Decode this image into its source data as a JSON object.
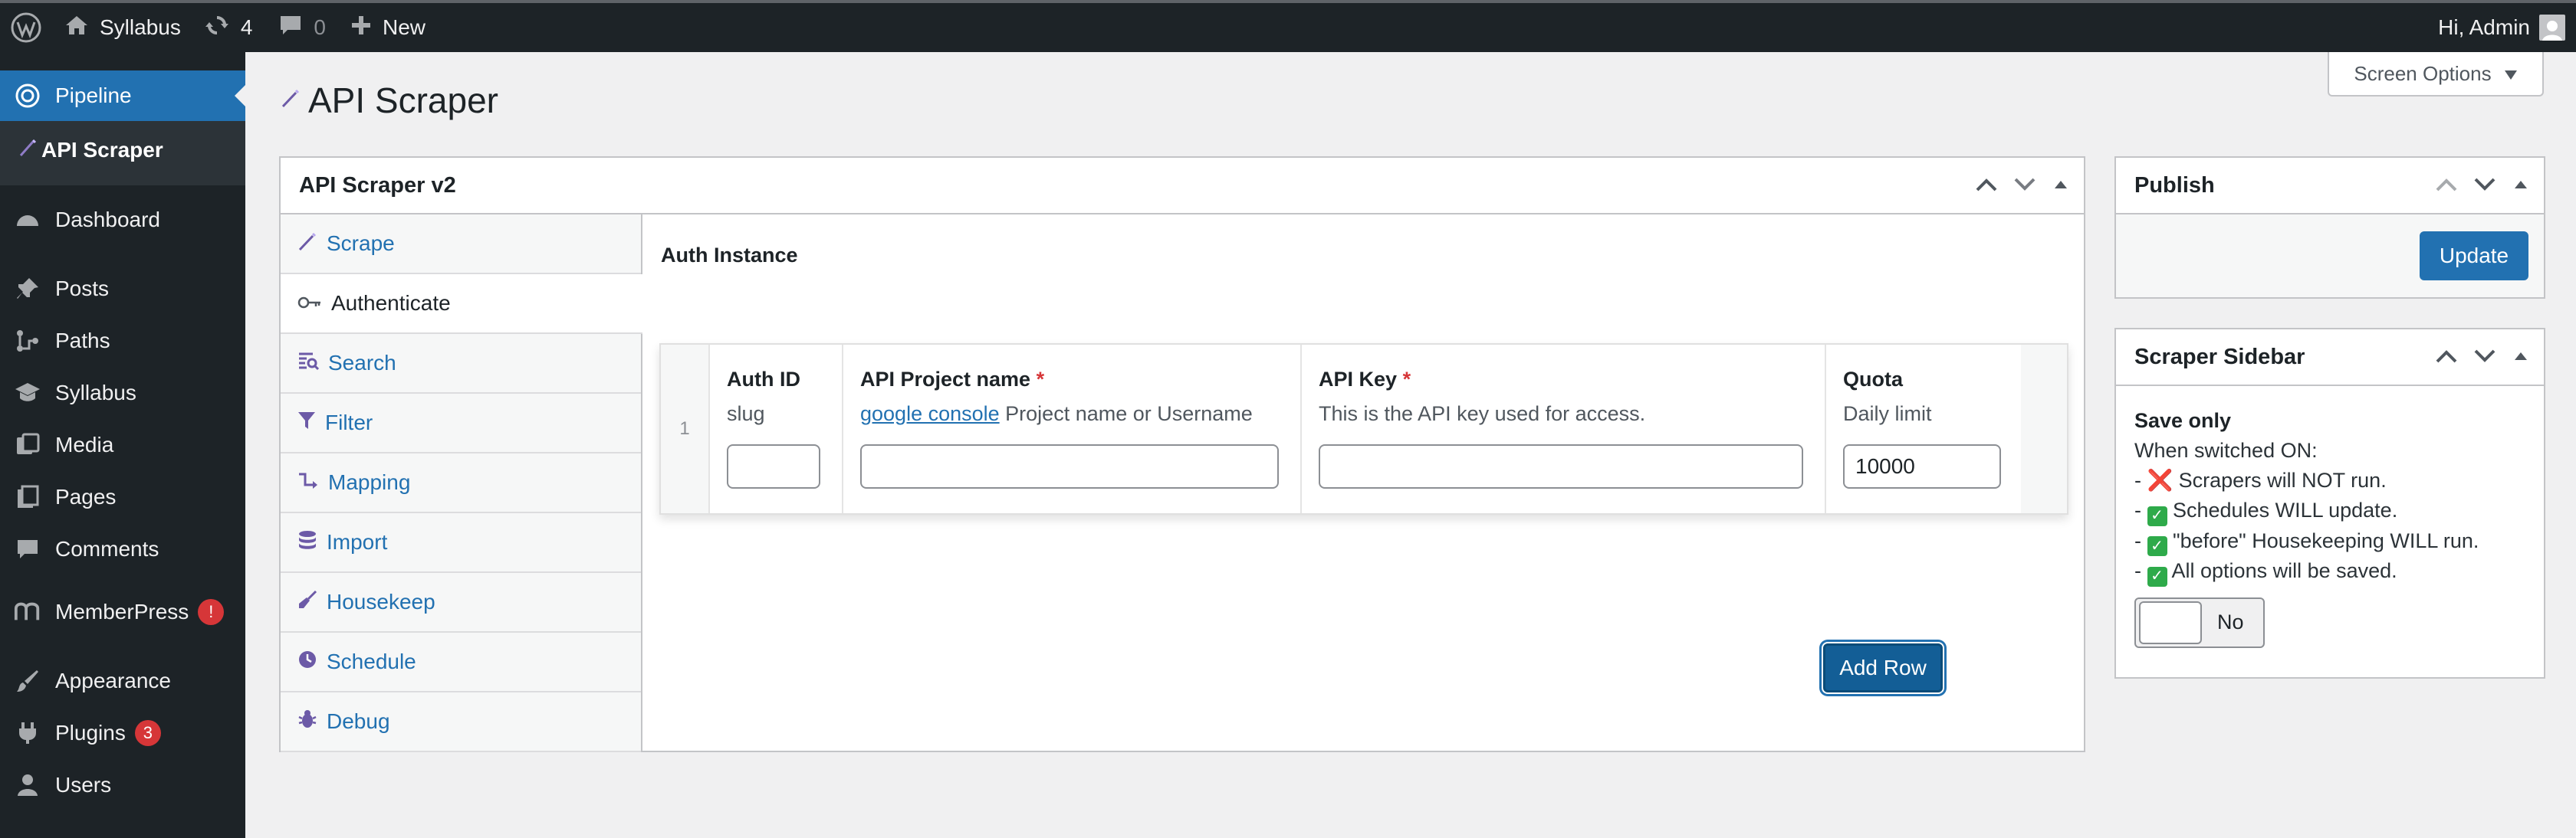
{
  "adminbar": {
    "site_name": "Syllabus",
    "updates_count": "4",
    "comments_count": "0",
    "new_label": "New",
    "greeting": "Hi, Admin"
  },
  "sidebar": {
    "items": [
      {
        "label": "Pipeline",
        "icon": "pipeline-icon"
      },
      {
        "label": "API Scraper",
        "icon": "scraper-wand-icon"
      },
      {
        "label": "Dashboard",
        "icon": "dashboard-icon"
      },
      {
        "label": "Posts",
        "icon": "pin-icon"
      },
      {
        "label": "Paths",
        "icon": "paths-icon"
      },
      {
        "label": "Syllabus",
        "icon": "graduation-icon"
      },
      {
        "label": "Media",
        "icon": "media-icon"
      },
      {
        "label": "Pages",
        "icon": "pages-icon"
      },
      {
        "label": "Comments",
        "icon": "comment-icon"
      },
      {
        "label": "MemberPress",
        "icon": "memberpress-icon",
        "alert": "!"
      },
      {
        "label": "Appearance",
        "icon": "brush-icon"
      },
      {
        "label": "Plugins",
        "icon": "plugin-icon",
        "badge": "3"
      },
      {
        "label": "Users",
        "icon": "user-icon"
      }
    ]
  },
  "header": {
    "screen_options": "Screen Options",
    "page_title": "API Scraper"
  },
  "main": {
    "box_title": "API Scraper v2",
    "tabs": [
      {
        "label": "Scrape",
        "icon": "wand-icon"
      },
      {
        "label": "Authenticate",
        "icon": "key-icon"
      },
      {
        "label": "Search",
        "icon": "search-list-icon"
      },
      {
        "label": "Filter",
        "icon": "filter-icon"
      },
      {
        "label": "Mapping",
        "icon": "mapping-icon"
      },
      {
        "label": "Import",
        "icon": "database-icon"
      },
      {
        "label": "Housekeep",
        "icon": "broom-icon"
      },
      {
        "label": "Schedule",
        "icon": "clock-icon"
      },
      {
        "label": "Debug",
        "icon": "bug-icon"
      }
    ],
    "active_tab": "Authenticate",
    "section_label": "Auth Instance",
    "row_number": "1",
    "columns": [
      {
        "label": "Auth ID",
        "required": false,
        "desc": "slug",
        "value": ""
      },
      {
        "label": "API Project name",
        "required": true,
        "link": "google console",
        "desc": " Project name or Username",
        "value": ""
      },
      {
        "label": "API Key",
        "required": true,
        "desc": "This is the API key used for access.",
        "value": ""
      },
      {
        "label": "Quota",
        "required": false,
        "desc": "Daily limit",
        "value": "10000"
      }
    ],
    "required_mark": "*",
    "add_row": "Add Row"
  },
  "publish": {
    "title": "Publish",
    "update_label": "Update"
  },
  "scraper_sidebar": {
    "title": "Scraper Sidebar",
    "heading": "Save only",
    "intro": "When switched ON:",
    "lines": [
      {
        "prefix": "- ",
        "mark": "x",
        "text": " Scrapers will NOT run."
      },
      {
        "prefix": "- ",
        "mark": "check",
        "text": " Schedules WILL update."
      },
      {
        "prefix": "- ",
        "mark": "check",
        "text": " \"before\" Housekeeping WILL run."
      },
      {
        "prefix": "- ",
        "mark": "check",
        "text": " All options will be saved."
      }
    ],
    "toggle_state": "No"
  },
  "colors": {
    "accent": "#2271b1",
    "sidebar_bg": "#1d2327",
    "alert": "#d63638",
    "check": "#2eaa4a",
    "tab_icon": "#6c5aa7"
  }
}
